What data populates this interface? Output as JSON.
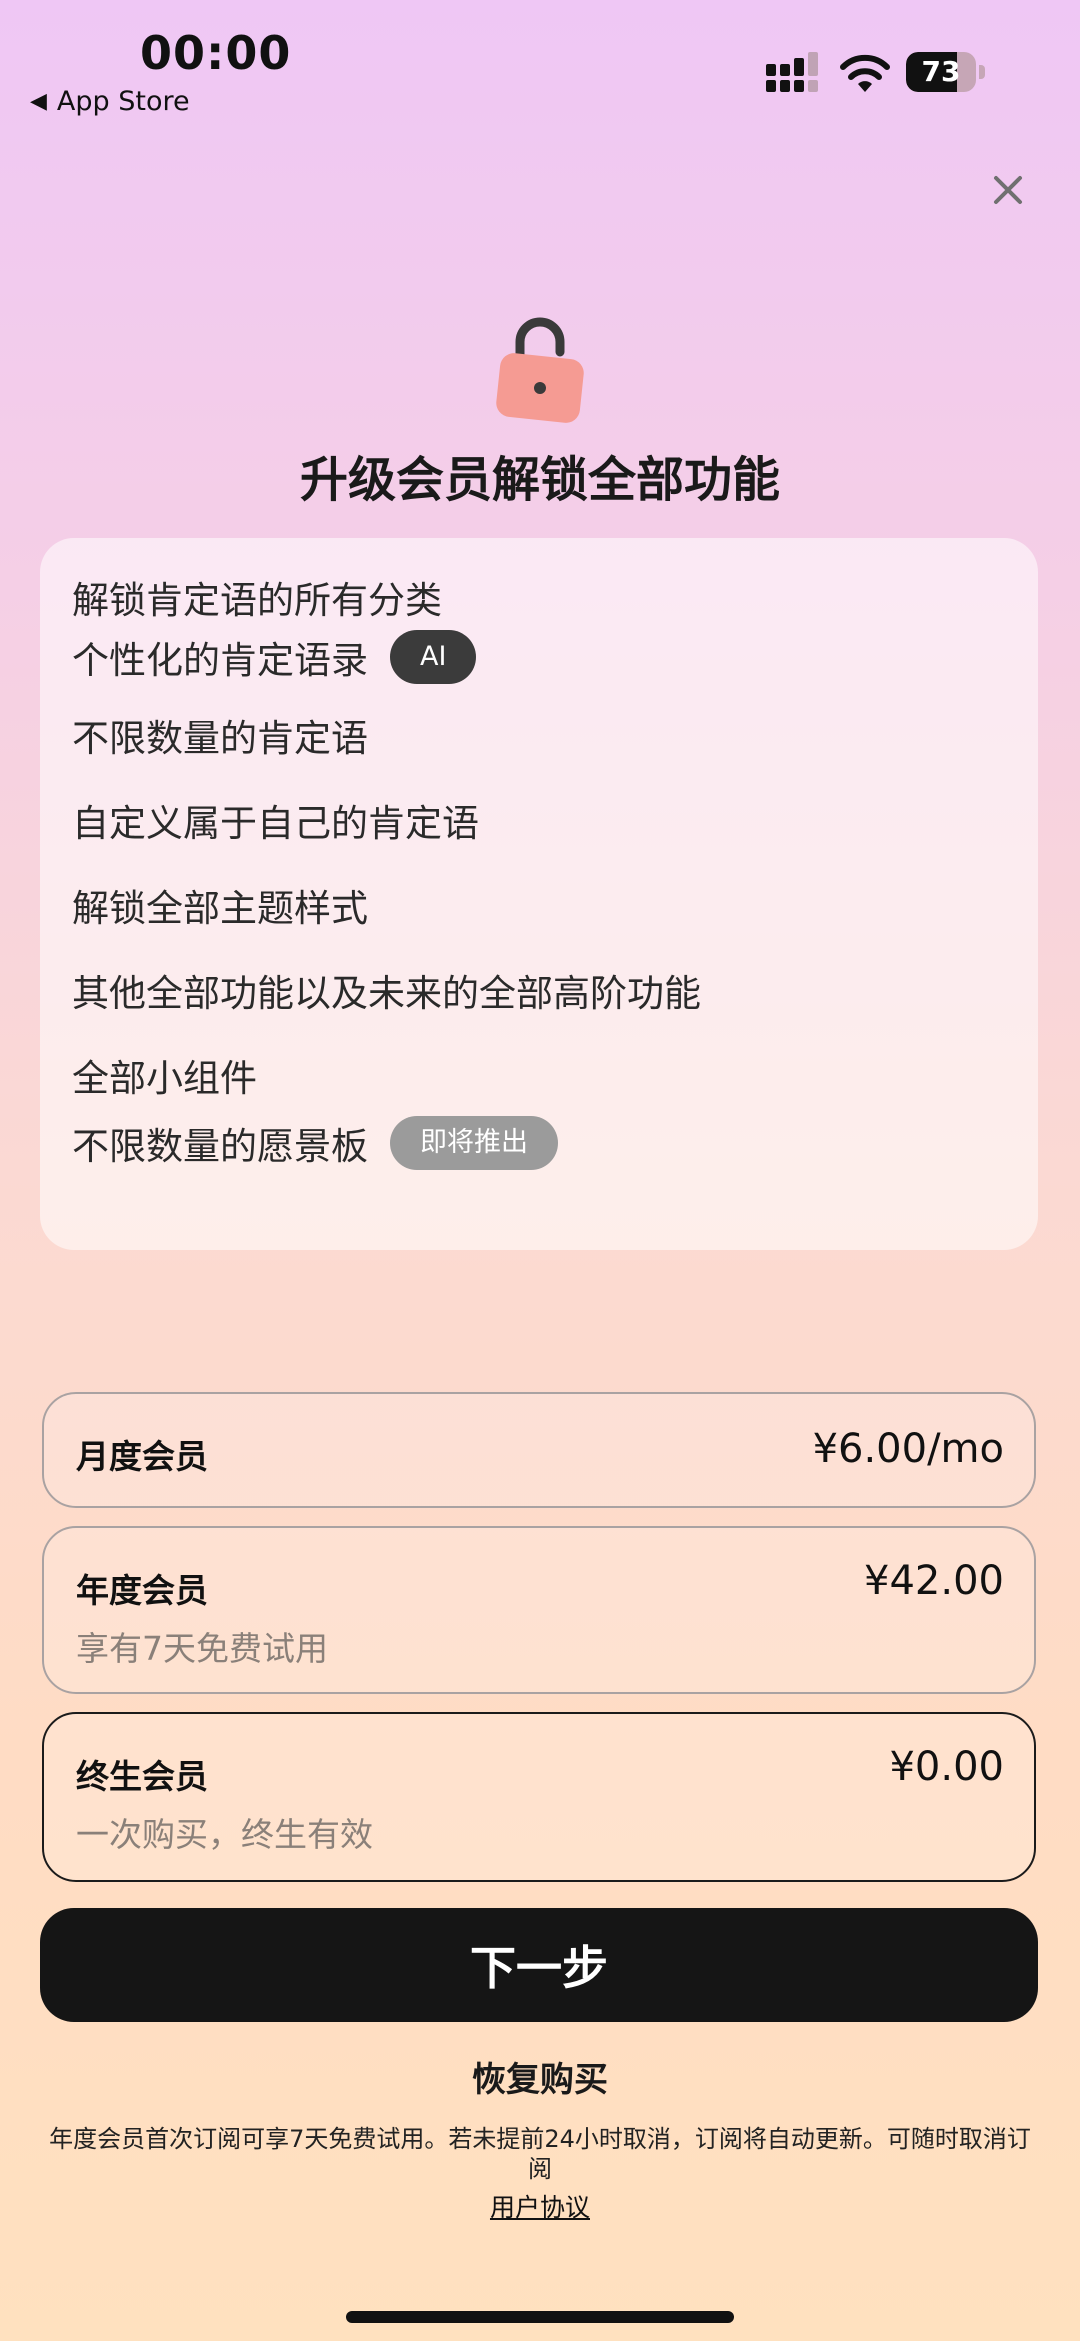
{
  "status_bar": {
    "time": "00:00",
    "back_label": "App Store",
    "battery_level": "73",
    "battery_fraction": 0.73
  },
  "icons": {
    "back": "back-arrow-icon",
    "signal": "cellular-signal-icon",
    "wifi": "wifi-icon",
    "battery": "battery-icon",
    "close": "close-icon",
    "lock": "lock-icon"
  },
  "header": {
    "title": "升级会员解锁全部功能"
  },
  "features": [
    {
      "label": "解锁肯定语的所有分类",
      "badge": null
    },
    {
      "label": "个性化的肯定语录",
      "badge": "AI"
    },
    {
      "label": "不限数量的肯定语",
      "badge": null
    },
    {
      "label": "自定义属于自己的肯定语",
      "badge": null
    },
    {
      "label": "解锁全部主题样式",
      "badge": null
    },
    {
      "label": "其他全部功能以及未来的全部高阶功能",
      "badge": null
    },
    {
      "label": "全部小组件",
      "badge": null
    },
    {
      "label": "不限数量的愿景板",
      "badge": "即将推出"
    }
  ],
  "plans": [
    {
      "name": "月度会员",
      "subtitle": null,
      "price": "¥6.00/mo",
      "selected": false
    },
    {
      "name": "年度会员",
      "subtitle": "享有7天免费试用",
      "price": "¥42.00",
      "selected": false
    },
    {
      "name": "终生会员",
      "subtitle": "一次购买，终生有效",
      "price": "¥0.00",
      "selected": true
    }
  ],
  "actions": {
    "next_label": "下一步",
    "restore_label": "恢复购买"
  },
  "footer": {
    "terms": "年度会员首次订阅可享7天免费试用。若未提前24小时取消，订阅将自动更新。可随时取消订阅",
    "agreement_link": "用户协议"
  },
  "colors": {
    "lock": "#f59b93",
    "button_bg": "#151515",
    "badge_dark": "#3b3b3b",
    "badge_gray": "#9b9b9b"
  }
}
